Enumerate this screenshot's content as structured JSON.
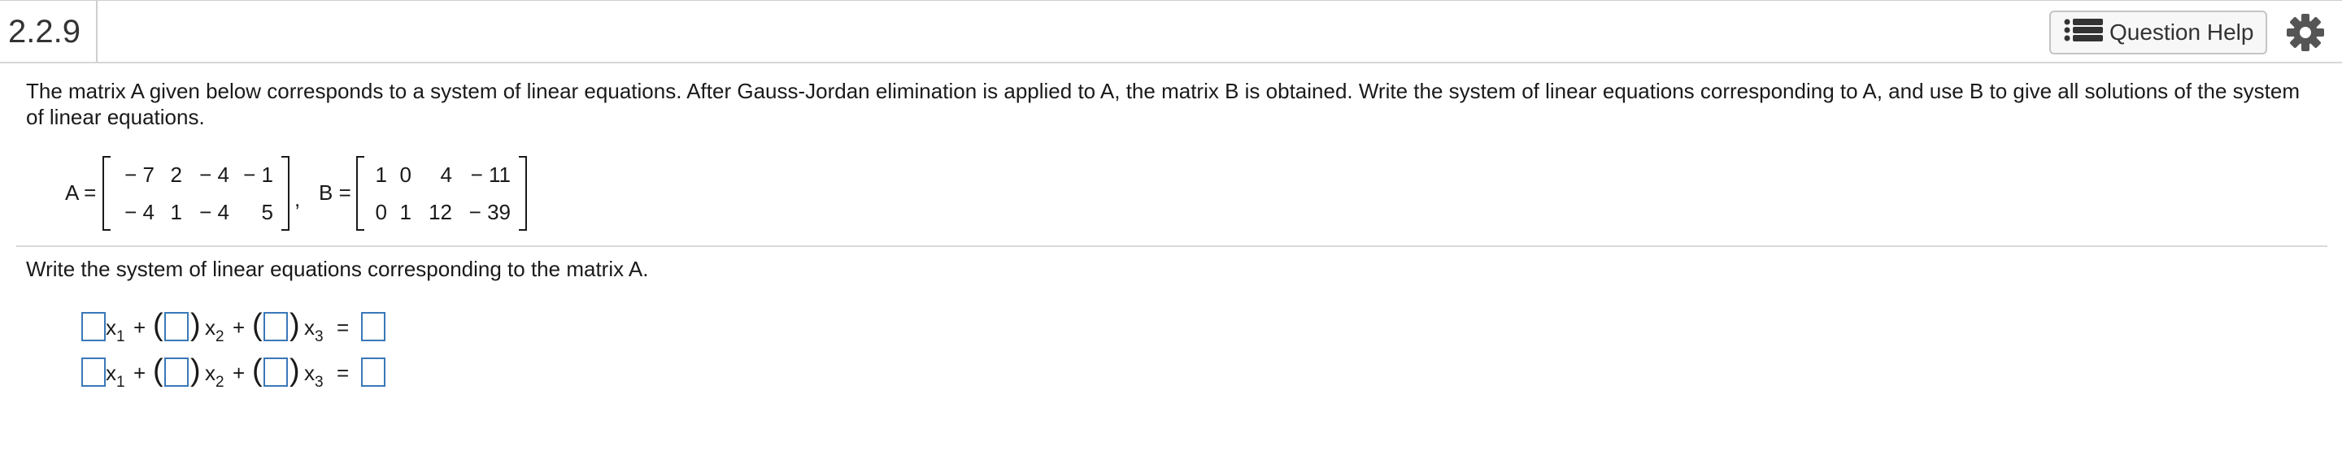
{
  "header": {
    "question_number": "2.2.9",
    "help_label": "Question Help",
    "help_icon": "list-icon",
    "settings_icon": "gear-icon"
  },
  "problem": {
    "text": "The matrix A given below corresponds to a system of linear equations. After Gauss-Jordan elimination is applied to A, the matrix B is obtained. Write the system of linear equations corresponding to A, and use B to give all solutions of the system of linear equations."
  },
  "matrices": {
    "A": {
      "label": "A =",
      "rows": [
        [
          "− 7",
          "2",
          "− 4",
          "− 1"
        ],
        [
          "− 4",
          "1",
          "− 4",
          "5"
        ]
      ]
    },
    "separator": ",",
    "B": {
      "label": "B =",
      "rows": [
        [
          "1",
          "0",
          "4",
          "− 11"
        ],
        [
          "0",
          "1",
          "12",
          "− 39"
        ]
      ]
    }
  },
  "part": {
    "instruction": "Write the system of linear equations corresponding to the matrix A."
  },
  "equations": [
    {
      "x1": "x",
      "x1_sub": "1",
      "plus1": "+",
      "x2": "x",
      "x2_sub": "2",
      "plus2": "+",
      "x3": "x",
      "x3_sub": "3",
      "equals": "=",
      "a1": "",
      "a2": "",
      "a3": "",
      "rhs": ""
    },
    {
      "x1": "x",
      "x1_sub": "1",
      "plus1": "+",
      "x2": "x",
      "x2_sub": "2",
      "plus2": "+",
      "x3": "x",
      "x3_sub": "3",
      "equals": "=",
      "a1": "",
      "a2": "",
      "a3": "",
      "rhs": ""
    }
  ]
}
